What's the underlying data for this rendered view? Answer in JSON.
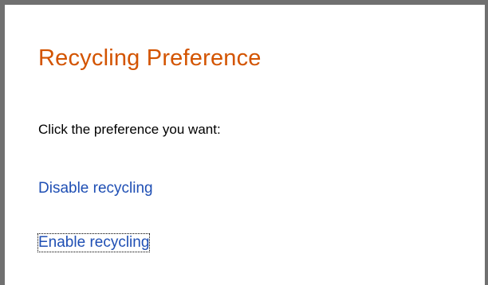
{
  "page": {
    "title": "Recycling Preference",
    "instruction": "Click the preference you want:"
  },
  "links": {
    "disable": "Disable recycling",
    "enable": "Enable recycling"
  },
  "colors": {
    "title": "#d35400",
    "link": "#1f4fb4",
    "frame": "#707070"
  }
}
